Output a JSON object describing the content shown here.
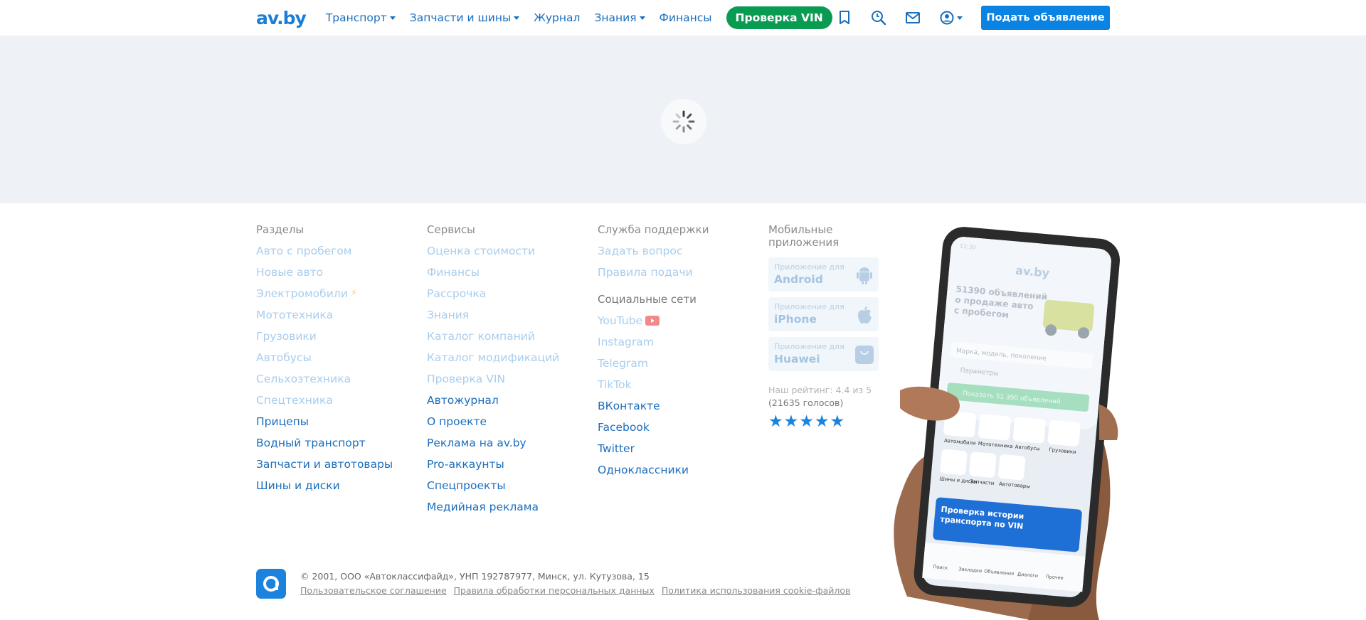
{
  "header": {
    "logo": "av.by",
    "nav": [
      {
        "label": "Транспорт",
        "dropdown": true
      },
      {
        "label": "Запчасти и шины",
        "dropdown": true
      },
      {
        "label": "Журнал",
        "dropdown": false
      },
      {
        "label": "Знания",
        "dropdown": true
      },
      {
        "label": "Финансы",
        "dropdown": false
      }
    ],
    "vin_button": "Проверка VIN",
    "icons": [
      "bookmark-icon",
      "search-history-icon",
      "mail-icon",
      "user-icon"
    ],
    "post_button": "Подать объявление"
  },
  "footer": {
    "sections": {
      "title": "Разделы",
      "links": [
        "Авто с пробегом",
        "Новые авто",
        "Электромобили",
        "Мототехника",
        "Грузовики",
        "Автобусы",
        "Сельхозтехника",
        "Спецтехника",
        "Прицепы",
        "Водный транспорт",
        "Запчасти и автотовары",
        "Шины и диски"
      ]
    },
    "services": {
      "title": "Сервисы",
      "links": [
        "Оценка стоимости",
        "Финансы",
        "Рассрочка",
        "Знания",
        "Каталог компаний",
        "Каталог модификаций",
        "Проверка VIN",
        "Автожурнал",
        "О проекте",
        "Реклама на av.by",
        "Pro-аккаунты",
        "Спецпроекты",
        "Медийная реклама"
      ]
    },
    "support": {
      "title": "Служба поддержки",
      "links": [
        "Задать вопрос",
        "Правила подачи"
      ]
    },
    "social": {
      "title": "Социальные сети",
      "links": [
        "YouTube",
        "Instagram",
        "Telegram",
        "TikTok",
        "ВКонтакте",
        "Facebook",
        "Twitter",
        "Одноклассники"
      ]
    },
    "mobile": {
      "title": "Мобильные приложения",
      "apps": [
        {
          "sub": "Приложение для",
          "name": "Android"
        },
        {
          "sub": "Приложение для",
          "name": "iPhone"
        },
        {
          "sub": "Приложение для",
          "name": "Huawei"
        }
      ],
      "rating": "Наш рейтинг: 4.4 из 5",
      "votes": "(21635 голосов)",
      "stars": 5
    },
    "copyright": "© 2001, ООО «Автоклассифайд», УНП 192787977, Минск, ул. Кутузова, 15",
    "legal_links": [
      "Пользовательское соглашение",
      "Правила обработки персональных данных",
      "Политика использования cookie-файлов"
    ]
  },
  "phone_screen": {
    "time": "12:30",
    "logo": "av.by",
    "headline": "51390 объявлений о продаже авто с пробегом",
    "search_placeholder": "Марка, модель, поколение",
    "params": "Параметры",
    "show_button": "Показать 51 390 объявлений",
    "categories": [
      "Автомобили",
      "Мототехника",
      "Автобусы",
      "Грузовики",
      "Шины и диски",
      "Запчасти",
      "Автотовары"
    ],
    "banner": "Проверка истории транспорта по VIN",
    "tabs": [
      "Поиск",
      "Закладки",
      "Объявления",
      "Диалоги",
      "Прочее"
    ]
  }
}
